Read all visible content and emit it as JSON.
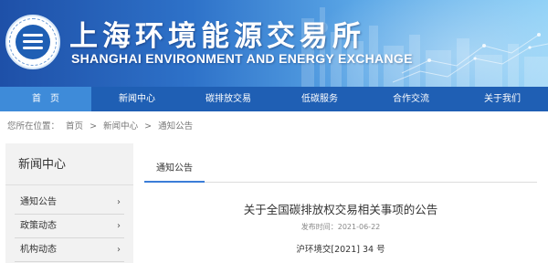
{
  "header": {
    "title_cn": "上海环境能源交易所",
    "title_en": "SHANGHAI ENVIRONMENT AND ENERGY EXCHANGE"
  },
  "nav": {
    "items": [
      {
        "label": "首　页",
        "active": true
      },
      {
        "label": "新闻中心",
        "active": false
      },
      {
        "label": "碳排放交易",
        "active": false
      },
      {
        "label": "低碳服务",
        "active": false
      },
      {
        "label": "合作交流",
        "active": false
      },
      {
        "label": "关于我们",
        "active": false
      }
    ]
  },
  "breadcrumb": {
    "prefix": "您所在位置：",
    "home": "首页",
    "sep": ">",
    "level1": "新闻中心",
    "level2": "通知公告"
  },
  "sidebar": {
    "title": "新闻中心",
    "arrow": "›",
    "items": [
      {
        "label": "通知公告"
      },
      {
        "label": "政策动态"
      },
      {
        "label": "机构动态"
      }
    ]
  },
  "content": {
    "tab": "通知公告",
    "article_title": "关于全国碳排放权交易相关事项的公告",
    "date_label": "发布时间：",
    "date": "2021-06-22",
    "doc_number": "沪环境交[2021] 34 号"
  },
  "colors": {
    "nav_bg": "#1f5fb4",
    "nav_active": "#3e8bd9",
    "banner_start": "#1e50a8",
    "banner_end": "#8ccff6"
  }
}
